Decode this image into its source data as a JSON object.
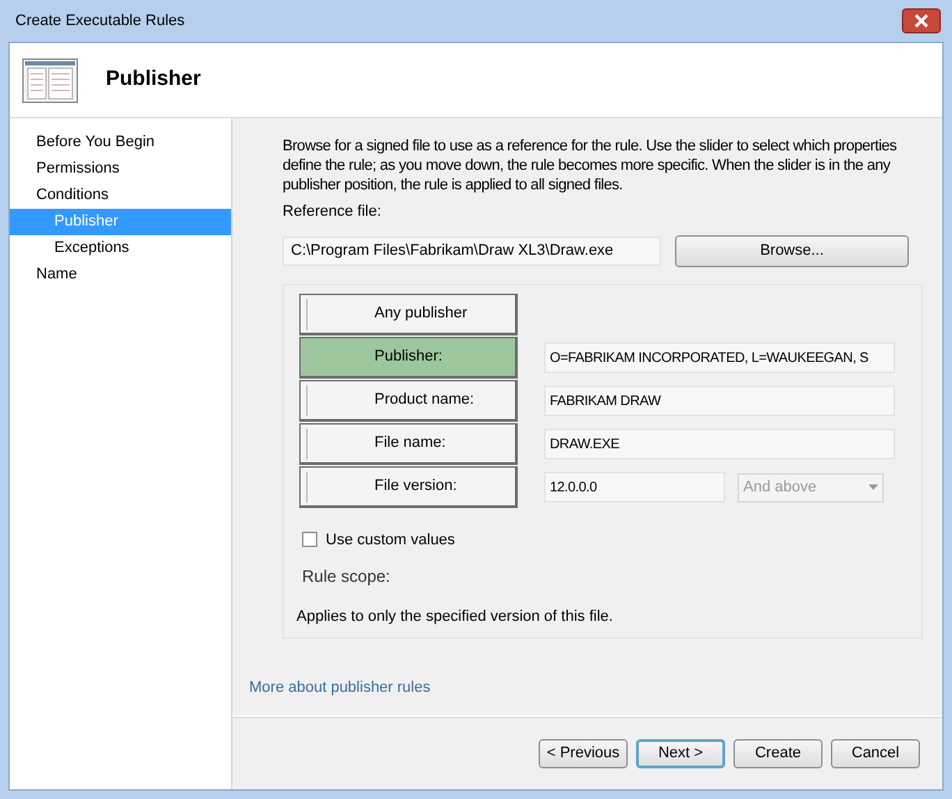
{
  "window": {
    "title": "Create Executable Rules"
  },
  "header": {
    "title": "Publisher"
  },
  "sidebar": {
    "items": [
      {
        "label": "Before You Begin",
        "selected": false
      },
      {
        "label": "Permissions",
        "selected": false
      },
      {
        "label": "Conditions",
        "selected": false,
        "children": [
          {
            "label": "Publisher",
            "selected": true
          },
          {
            "label": "Exceptions",
            "selected": false
          }
        ]
      },
      {
        "label": "Name",
        "selected": false
      }
    ]
  },
  "description": "Browse for a signed file to use as a reference for the rule. Use the slider to select which properties define the rule; as you move down, the rule becomes more specific. When the slider is in the any publisher position, the rule is applied to all signed files.",
  "reference_file": {
    "label": "Reference file:",
    "value": "C:\\Program Files\\Fabrikam\\Draw XL3\\Draw.exe",
    "browse_button": "Browse..."
  },
  "slider": {
    "positions": [
      {
        "label": "Any publisher",
        "selected": false
      },
      {
        "label": "Publisher:",
        "selected": true,
        "value": "O=FABRIKAM INCORPORATED, L=WAUKEEGAN, S"
      },
      {
        "label": "Product name:",
        "selected": false,
        "value": "FABRIKAM DRAW"
      },
      {
        "label": "File name:",
        "selected": false,
        "value": "DRAW.EXE"
      },
      {
        "label": "File version:",
        "selected": false,
        "value": "12.0.0.0",
        "dropdown": {
          "value": "And above",
          "disabled": true
        }
      }
    ]
  },
  "custom_values": {
    "label": "Use custom values",
    "checked": false
  },
  "rule_scope": {
    "label": "Rule scope:",
    "text": "Applies to only the specified version of this file."
  },
  "link": "More about publisher rules",
  "buttons": [
    {
      "label": "< Previous",
      "default": false
    },
    {
      "label": "Next >",
      "default": true
    },
    {
      "label": "Create",
      "default": false
    },
    {
      "label": "Cancel",
      "default": false
    }
  ]
}
